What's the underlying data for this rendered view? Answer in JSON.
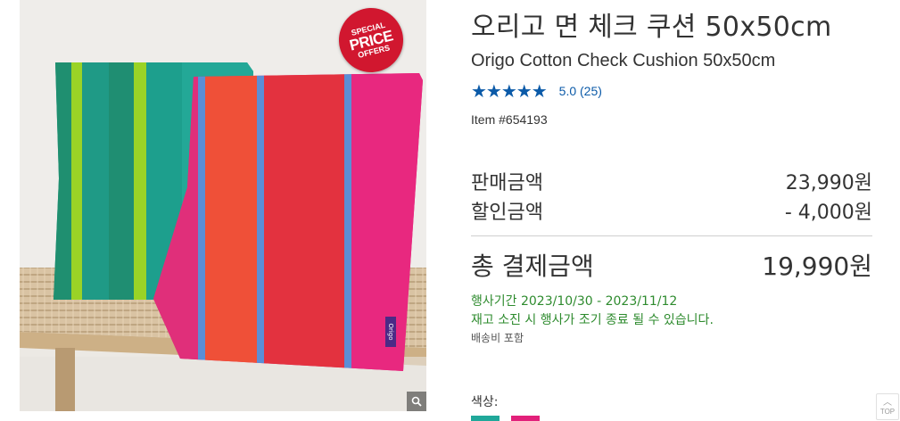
{
  "badge": {
    "line1": "SPECIAL",
    "line2": "PRICE",
    "line3": "OFFERS"
  },
  "image": {
    "tag_text": "Origo"
  },
  "product": {
    "title_kr": "오리고 면 체크 쿠션 50x50cm",
    "title_en": "Origo Cotton Check Cushion 50x50cm",
    "stars": "★★★★★",
    "rating_text": "5.0 (25)",
    "item_number": "Item #654193"
  },
  "price": {
    "sale_label": "판매금액",
    "sale_value": "23,990원",
    "discount_label": "할인금액",
    "discount_value": "- 4,000원",
    "total_label": "총 결제금액",
    "total_value": "19,990원"
  },
  "promo": {
    "period": "행사기간 2023/10/30 - 2023/11/12",
    "note": "재고 소진 시 행사가 조기 종료 될 수 있습니다.",
    "shipping": "배송비 포함"
  },
  "options": {
    "color_label": "색상:",
    "swatches": [
      "#20a89a",
      "#e2207a"
    ]
  },
  "top_button": {
    "label": "TOP"
  },
  "colors": {
    "accent_blue": "#0b5aa8",
    "promo_green": "#2e8b2e",
    "badge_red": "#d1172f"
  },
  "icons": [
    "zoom-icon",
    "star-icon",
    "chevron-up-icon"
  ]
}
